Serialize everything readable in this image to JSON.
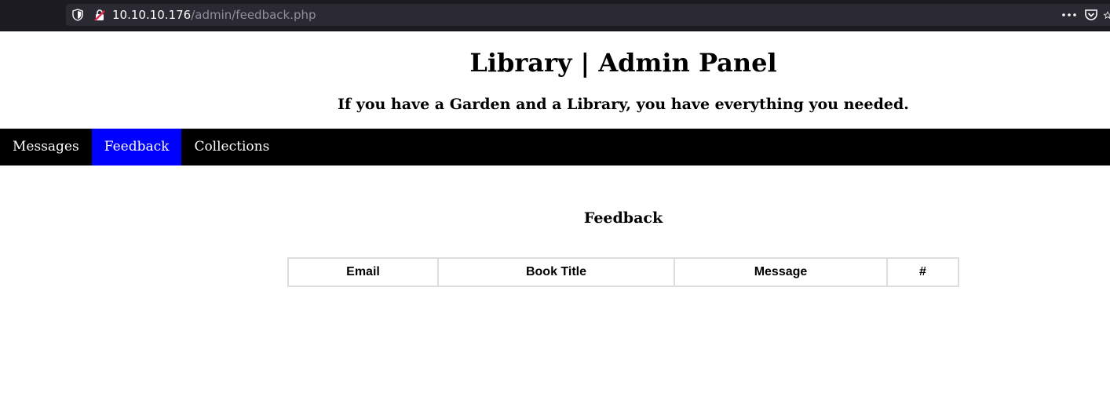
{
  "browser": {
    "url_host": "10.10.10.176",
    "url_path": "/admin/feedback.php",
    "icons": [
      "shield-icon",
      "insecure-lock-icon",
      "more-dots-icon",
      "pocket-icon",
      "bookmark-star-icon"
    ]
  },
  "header": {
    "title": "Library | Admin Panel",
    "tagline": "If you have a Garden and a Library, you have everything you needed."
  },
  "nav": {
    "items": [
      {
        "label": "Messages"
      },
      {
        "label": "Feedback"
      },
      {
        "label": "Collections"
      }
    ],
    "active_color": "#0000ff",
    "background": "#000000"
  },
  "main": {
    "section_title": "Feedback",
    "table": {
      "headers": [
        "Email",
        "Book Title",
        "Message",
        "#"
      ]
    }
  }
}
